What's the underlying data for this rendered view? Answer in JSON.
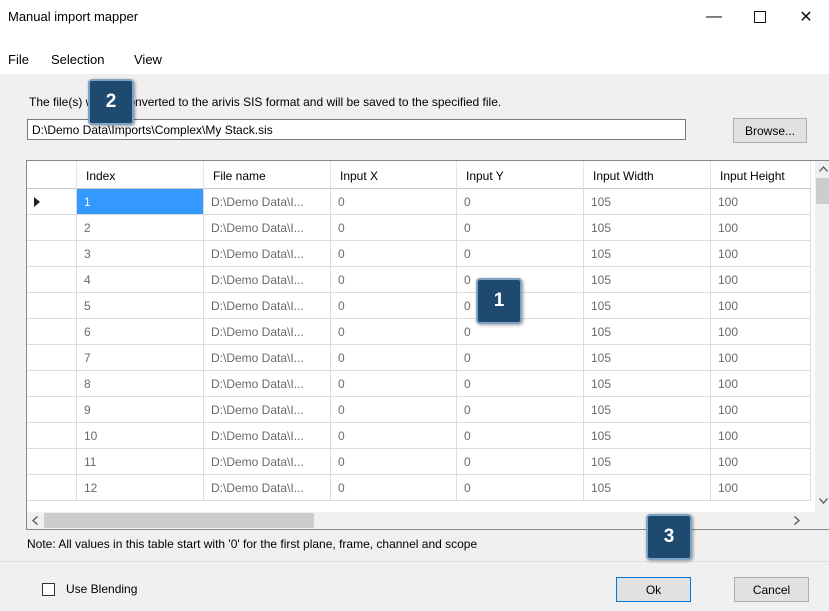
{
  "window": {
    "title": "Manual import mapper"
  },
  "menu": [
    "File",
    "Selection",
    "View"
  ],
  "info_text": "The file(s) will be converted to the arivis SIS format and will be saved to the specified file.",
  "output_path": "D:\\Demo Data\\Imports\\Complex\\My Stack.sis",
  "browse_label": "Browse...",
  "table": {
    "columns": [
      "Index",
      "File name",
      "Input X",
      "Input Y",
      "Input Width",
      "Input Height"
    ],
    "rows": [
      [
        "1",
        "D:\\Demo Data\\I...",
        "0",
        "0",
        "105",
        "100"
      ],
      [
        "2",
        "D:\\Demo Data\\I...",
        "0",
        "0",
        "105",
        "100"
      ],
      [
        "3",
        "D:\\Demo Data\\I...",
        "0",
        "0",
        "105",
        "100"
      ],
      [
        "4",
        "D:\\Demo Data\\I...",
        "0",
        "0",
        "105",
        "100"
      ],
      [
        "5",
        "D:\\Demo Data\\I...",
        "0",
        "0",
        "105",
        "100"
      ],
      [
        "6",
        "D:\\Demo Data\\I...",
        "0",
        "0",
        "105",
        "100"
      ],
      [
        "7",
        "D:\\Demo Data\\I...",
        "0",
        "0",
        "105",
        "100"
      ],
      [
        "8",
        "D:\\Demo Data\\I...",
        "0",
        "0",
        "105",
        "100"
      ],
      [
        "9",
        "D:\\Demo Data\\I...",
        "0",
        "0",
        "105",
        "100"
      ],
      [
        "10",
        "D:\\Demo Data\\I...",
        "0",
        "0",
        "105",
        "100"
      ],
      [
        "11",
        "D:\\Demo Data\\I...",
        "0",
        "0",
        "105",
        "100"
      ],
      [
        "12",
        "D:\\Demo Data\\I...",
        "0",
        "0",
        "105",
        "100"
      ]
    ],
    "selected_row": 0
  },
  "note": "Note: All values in this table start with '0' for the first plane, frame, channel and scope",
  "use_blending_label": "Use Blending",
  "use_blending_checked": false,
  "ok_label": "Ok",
  "cancel_label": "Cancel",
  "callouts": [
    "1",
    "2",
    "3"
  ],
  "colors": {
    "callout_bg": "#1e4a70",
    "selected_cell": "#3399ff"
  }
}
